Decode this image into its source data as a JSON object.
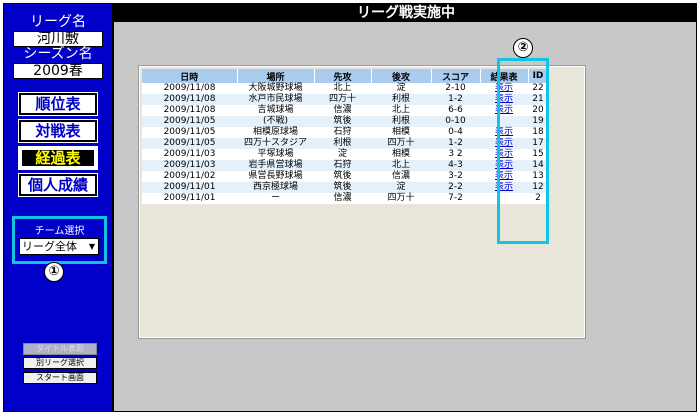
{
  "sidebar": {
    "league_label": "リーグ名",
    "league_name": "河川敷",
    "season_label": "シーズン名",
    "season_name": "2009春",
    "nav": [
      {
        "label": "順位表",
        "active": false
      },
      {
        "label": "対戦表",
        "active": false
      },
      {
        "label": "経過表",
        "active": true
      },
      {
        "label": "個人成績",
        "active": false
      }
    ],
    "team_select_label": "チーム選択",
    "team_select_value": "リーグ全体",
    "callout1": "①",
    "bottom_buttons": [
      {
        "label": "タイトル表彰",
        "disabled": true
      },
      {
        "label": "別リーグ選択",
        "disabled": false
      },
      {
        "label": "スタート画面",
        "disabled": false
      }
    ]
  },
  "header": {
    "title": "リーグ戦実施中"
  },
  "callout2": "②",
  "table": {
    "columns": [
      "日時",
      "場所",
      "先攻",
      "後攻",
      "スコア",
      "結果表",
      "ID"
    ],
    "rows": [
      [
        "2009/11/08",
        "大阪城野球場",
        "北上",
        "淀",
        "2-10",
        "表示",
        "22"
      ],
      [
        "2009/11/08",
        "水戸市民球場",
        "四万十",
        "利根",
        "1-2",
        "表示",
        "21"
      ],
      [
        "2009/11/08",
        "吉城球場",
        "信濃",
        "北上",
        "6-6",
        "表示",
        "20"
      ],
      [
        "2009/11/05",
        "(不戦)",
        "筑後",
        "利根",
        "0-10",
        "",
        "19"
      ],
      [
        "2009/11/05",
        "相模原球場",
        "石狩",
        "相模",
        "0-4",
        "表示",
        "18"
      ],
      [
        "2009/11/05",
        "四万十スタジア",
        "利根",
        "四万十",
        "1-2",
        "表示",
        "17"
      ],
      [
        "2009/11/03",
        "平塚球場",
        "淀",
        "相模",
        "3 2",
        "表示",
        "15"
      ],
      [
        "2009/11/03",
        "岩手県営球場",
        "石狩",
        "北上",
        "4-3",
        "表示",
        "14"
      ],
      [
        "2009/11/02",
        "県営長野球場",
        "筑後",
        "信濃",
        "3-2",
        "表示",
        "13"
      ],
      [
        "2009/11/01",
        "西京極球場",
        "筑後",
        "淀",
        "2-2",
        "表示",
        "12"
      ],
      [
        "2009/11/01",
        "ー",
        "信濃",
        "四万十",
        "7-2",
        "",
        "2"
      ]
    ]
  }
}
